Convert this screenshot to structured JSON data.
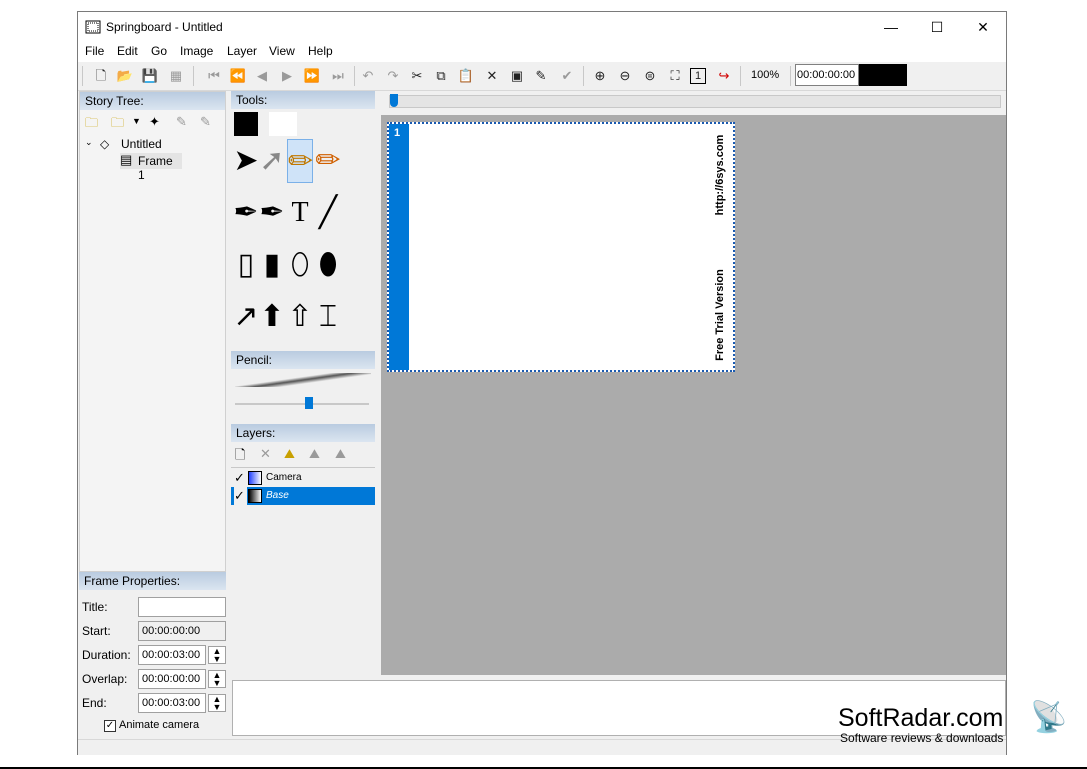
{
  "window": {
    "title": "Springboard - Untitled",
    "controls": {
      "minimize": "—",
      "maximize": "☐",
      "close": "✕"
    }
  },
  "menu": [
    "File",
    "Edit",
    "Go",
    "Image",
    "Layer",
    "View",
    "Help"
  ],
  "toolbar": {
    "zoom": "100%",
    "timecode": "00:00:00:00",
    "actual_size_label": "1"
  },
  "story_tree": {
    "header": "Story Tree:",
    "root": "Untitled",
    "frame": "Frame 1"
  },
  "tools": {
    "header": "Tools:",
    "pencil_header": "Pencil:",
    "pencil_size_fraction": 0.55,
    "layers_header": "Layers:",
    "layers": [
      {
        "name": "Camera",
        "visible": true,
        "selected": false
      },
      {
        "name": "Base",
        "visible": true,
        "selected": true
      }
    ]
  },
  "frame_properties": {
    "header": "Frame Properties:",
    "title_label": "Title:",
    "title_value": "",
    "start_label": "Start:",
    "start_value": "00:00:00:00",
    "duration_label": "Duration:",
    "duration_value": "00:00:03:00",
    "overlap_label": "Overlap:",
    "overlap_value": "00:00:00:00",
    "end_label": "End:",
    "end_value": "00:00:03:00",
    "animate_camera_label": "Animate camera",
    "animate_camera_checked": true
  },
  "canvas": {
    "frame_number": "1",
    "watermark_top": "http://6sys.com",
    "watermark_bottom": "Free Trial Version"
  },
  "overlay": {
    "brand": "SoftRadar.com",
    "tagline": "Software reviews & downloads"
  },
  "colors": {
    "accent": "#0078d7",
    "panel_header": "#c5d5e8",
    "canvas_bg": "#ababab"
  }
}
